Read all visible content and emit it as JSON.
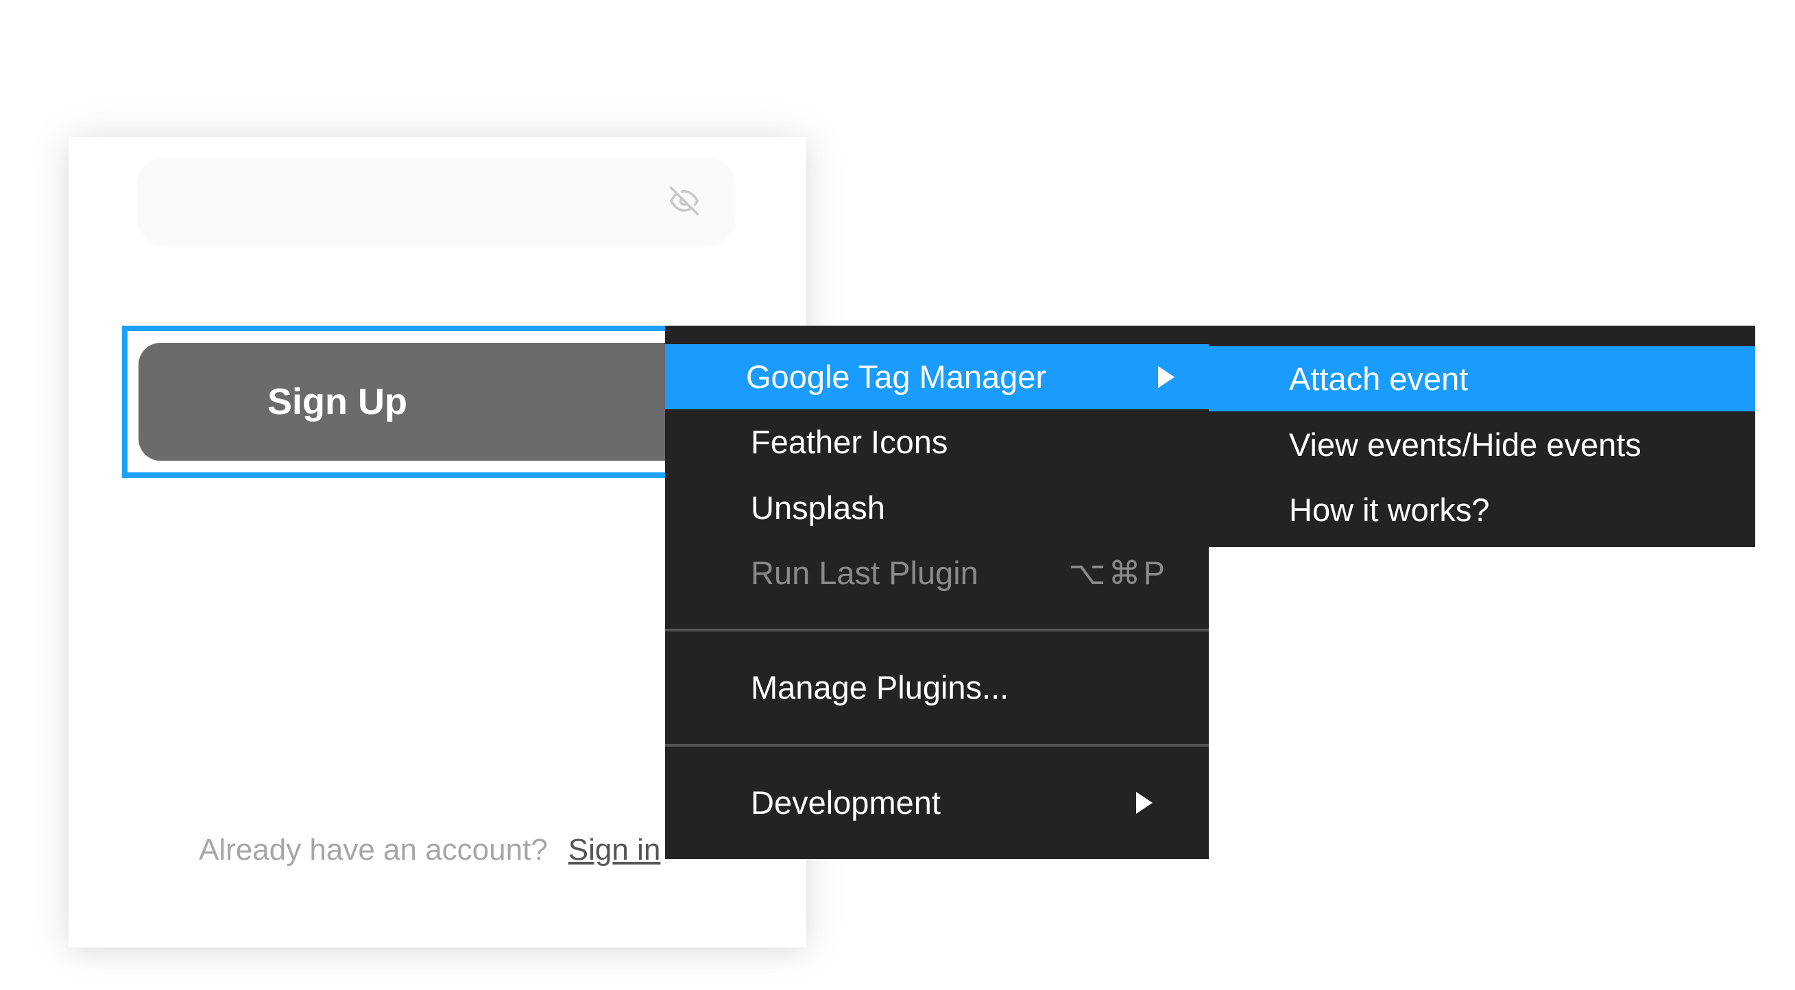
{
  "form": {
    "signup_label": "Sign Up",
    "already_text": "Already have an account?",
    "signin_label": "Sign in"
  },
  "plugins_menu": {
    "items": [
      {
        "label": "Google Tag Manager",
        "submenu": true,
        "highlighted": true
      },
      {
        "label": "Feather Icons"
      },
      {
        "label": "Unsplash"
      },
      {
        "label": "Run Last Plugin",
        "shortcut": "⌥⌘P",
        "disabled": true
      },
      {
        "label": "Manage Plugins..."
      },
      {
        "label": "Development",
        "submenu": true
      }
    ]
  },
  "gtm_submenu": {
    "items": [
      {
        "label": "Attach event",
        "highlighted": true
      },
      {
        "label": "View events/Hide events"
      },
      {
        "label": "How it works?"
      }
    ]
  },
  "colors": {
    "highlight": "#1a9cff",
    "menu_bg": "#232323",
    "button_bg": "#6b6b6b",
    "selection": "#1ea0ff"
  },
  "icons": {
    "password_toggle": "eye-off-icon",
    "submenu_arrow": "chevron-right-icon"
  }
}
